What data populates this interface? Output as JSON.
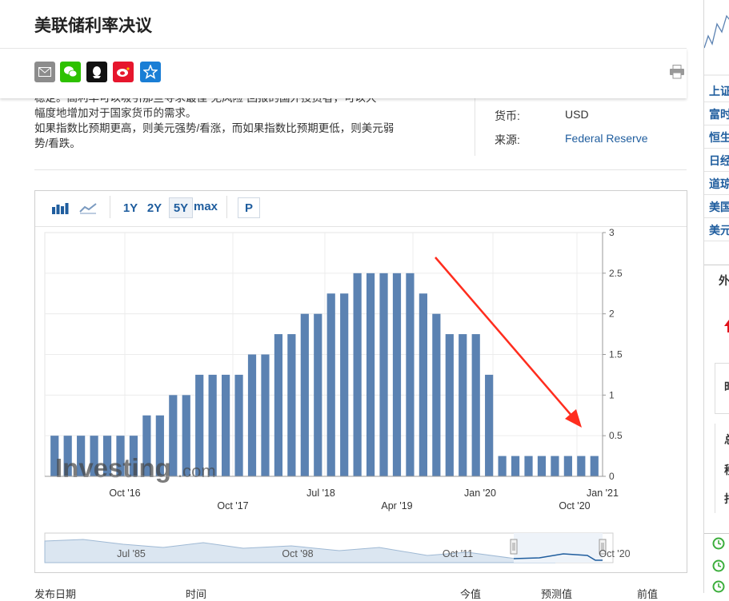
{
  "page": {
    "title": "美联储利率决议"
  },
  "share_icons": [
    {
      "name": "email-icon",
      "glyph": "✉",
      "color": "#888888"
    },
    {
      "name": "wechat-icon",
      "glyph": "●",
      "color": "#2dc100"
    },
    {
      "name": "qq-icon",
      "glyph": "◆",
      "color": "#111111"
    },
    {
      "name": "weibo-icon",
      "glyph": "◉",
      "color": "#e6162d"
    },
    {
      "name": "star-icon",
      "glyph": "★",
      "color": "#1a7ed5"
    }
  ],
  "description": {
    "line1": "稳定。高利率可以吸引那些寻求最佳“无风险”回报的国外投资者，可以大",
    "line2": "幅度地增加对于国家货币的需求。",
    "line3": "如果指数比预期更高，则美元强势/看涨，而如果指数比预期更低，则美元弱",
    "line4": "势/看跌。"
  },
  "info": {
    "currency_label": "货币:",
    "currency_value": "USD",
    "source_label": "来源:",
    "source_value": "Federal Reserve"
  },
  "toolbar": {
    "r1y": "1Y",
    "r2y": "2Y",
    "r5y": "5Y",
    "rmax": "max",
    "p": "P"
  },
  "right_panel": {
    "links": [
      "上证",
      "富时",
      "恒生",
      "日经",
      "道琼",
      "美国",
      "美元"
    ],
    "tab": "外",
    "rows": [
      "时",
      "总",
      "移",
      "指"
    ]
  },
  "bottom_labels": [
    "发布日期",
    "时间",
    "今值",
    "预测值",
    "前值"
  ],
  "chart_data": {
    "type": "bar",
    "color": "#5b82b2",
    "arrow_color": "#ff2d1e",
    "watermark": "Investing.com",
    "ylim": [
      0,
      3
    ],
    "yticks": [
      "0",
      "0.5",
      "1",
      "1.5",
      "2",
      "2.5",
      "3"
    ],
    "xticks_row1": [
      "Oct '16",
      "Jul '18",
      "Jan '20",
      "Jan '21"
    ],
    "xticks_row2": [
      "Oct '17",
      "Apr '19",
      "Oct '20"
    ],
    "values": [
      0.5,
      0.5,
      0.5,
      0.5,
      0.5,
      0.5,
      0.5,
      0.75,
      0.75,
      1.0,
      1.0,
      1.25,
      1.25,
      1.25,
      1.25,
      1.5,
      1.5,
      1.75,
      1.75,
      2.0,
      2.0,
      2.25,
      2.25,
      2.5,
      2.5,
      2.5,
      2.5,
      2.5,
      2.25,
      2.0,
      1.75,
      1.75,
      1.75,
      1.25,
      0.25,
      0.25,
      0.25,
      0.25,
      0.25,
      0.25,
      0.25,
      0.25
    ],
    "navigator": {
      "labels": [
        "Jul '85",
        "Oct '98",
        "Oct '11",
        "Oct '20"
      ]
    }
  }
}
